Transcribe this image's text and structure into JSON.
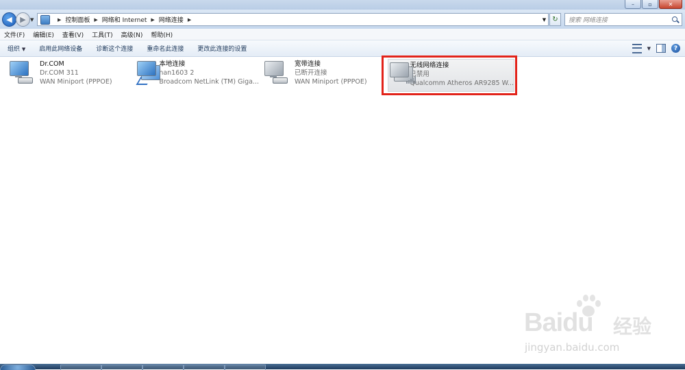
{
  "window": {
    "controls": {
      "minimize": "–",
      "maximize": "▫",
      "close": "✕"
    }
  },
  "address": {
    "crumbs": [
      "控制面板",
      "网络和 Internet",
      "网络连接"
    ],
    "search_placeholder": "搜索 网络连接"
  },
  "menu": [
    "文件(F)",
    "编辑(E)",
    "查看(V)",
    "工具(T)",
    "高级(N)",
    "帮助(H)"
  ],
  "toolbar": {
    "organize": "组织",
    "items": [
      "启用此网络设备",
      "诊断这个连接",
      "重命名此连接",
      "更改此连接的设置"
    ]
  },
  "connections": [
    {
      "name": "Dr.COM",
      "status": "Dr.COM  311",
      "device": "WAN Miniport (PPPOE)",
      "icon": "dialup-connection-icon"
    },
    {
      "name": "本地连接",
      "status": "han1603  2",
      "device": "Broadcom NetLink (TM) Giga...",
      "icon": "lan-connection-icon"
    },
    {
      "name": "宽带连接",
      "status": "已断开连接",
      "device": "WAN Miniport (PPPOE)",
      "icon": "broadband-connection-icon"
    },
    {
      "name": "无线网络连接",
      "status": "已禁用",
      "device": "Qualcomm Atheros AR9285 W...",
      "icon": "wireless-connection-icon"
    }
  ],
  "watermark": {
    "brand_left": "Bai",
    "brand_right": "du",
    "cn": "经验",
    "url": "jingyan.baidu.com"
  },
  "colors": {
    "highlight": "#e2231a",
    "toolbar_text": "#1e395b"
  }
}
